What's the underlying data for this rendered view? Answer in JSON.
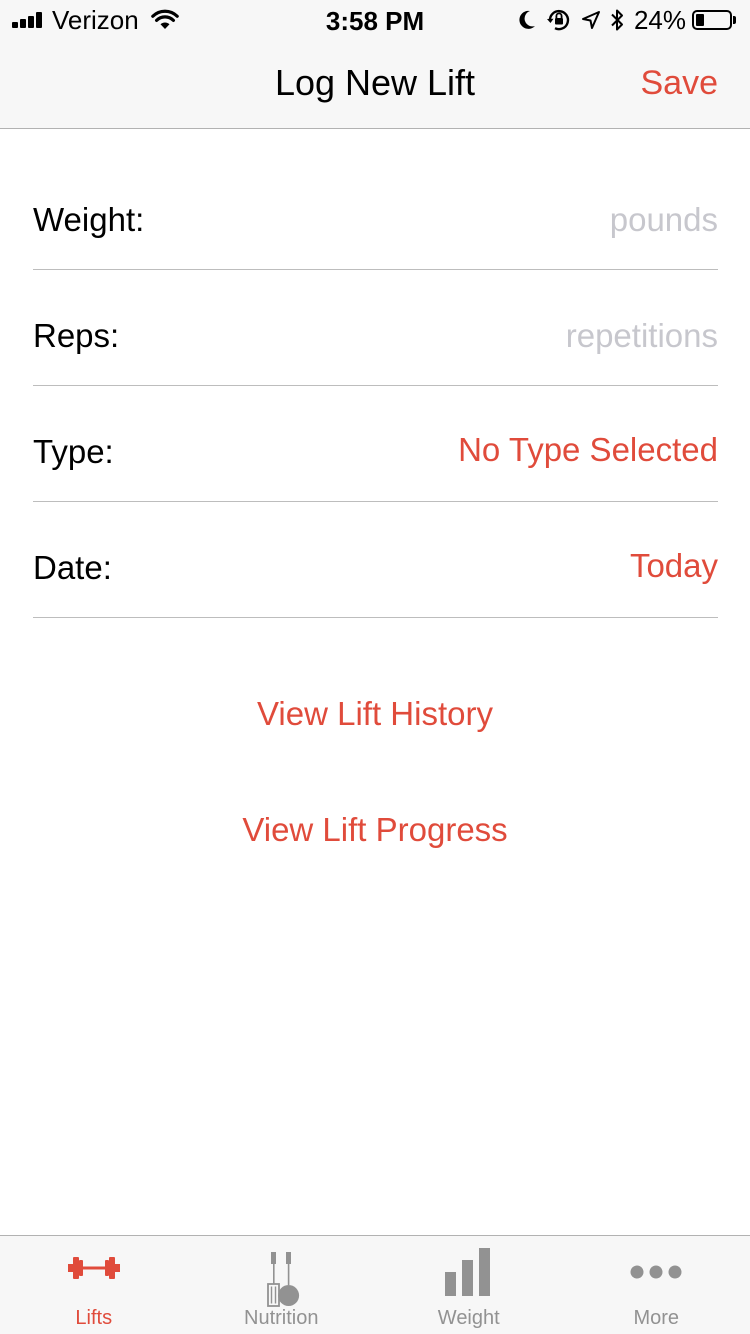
{
  "status_bar": {
    "carrier": "Verizon",
    "time": "3:58 PM",
    "battery_percent": "24%",
    "battery_level": 0.24,
    "icons": [
      "signal-icon",
      "wifi-icon",
      "moon-icon",
      "orientation-lock-icon",
      "location-arrow-icon",
      "bluetooth-icon",
      "battery-icon"
    ]
  },
  "nav": {
    "title": "Log New Lift",
    "save_label": "Save"
  },
  "form": {
    "weight": {
      "label": "Weight:",
      "value": "",
      "placeholder": "pounds"
    },
    "reps": {
      "label": "Reps:",
      "value": "",
      "placeholder": "repetitions"
    },
    "type": {
      "label": "Type:",
      "value": "No Type Selected"
    },
    "date": {
      "label": "Date:",
      "value": "Today"
    }
  },
  "actions": {
    "history_label": "View Lift History",
    "progress_label": "View Lift Progress"
  },
  "tabs": [
    {
      "label": "Lifts",
      "icon": "dumbbell-icon",
      "active": true
    },
    {
      "label": "Nutrition",
      "icon": "utensils-icon",
      "active": false
    },
    {
      "label": "Weight",
      "icon": "bar-chart-icon",
      "active": false
    },
    {
      "label": "More",
      "icon": "more-dots-icon",
      "active": false
    }
  ],
  "colors": {
    "accent": "#e04b3b",
    "inactive": "#929292",
    "placeholder": "#c7c7cd",
    "bar_background": "#f7f7f7"
  }
}
